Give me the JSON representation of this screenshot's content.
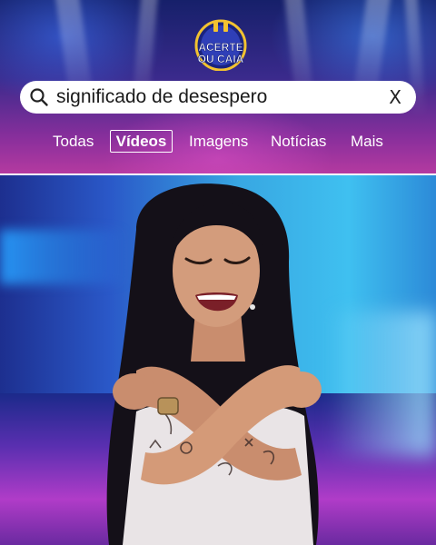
{
  "banner": {
    "logo_text_line1": "ACERTE",
    "logo_text_line2": "OU CAIA"
  },
  "search": {
    "query": "significado de desespero",
    "clear_label": "X"
  },
  "tabs": [
    {
      "label": "Todas",
      "selected": false
    },
    {
      "label": "Vídeos",
      "selected": true
    },
    {
      "label": "Imagens",
      "selected": false
    },
    {
      "label": "Notícias",
      "selected": false
    },
    {
      "label": "Mais",
      "selected": false
    }
  ],
  "icons": {
    "search": "search-icon",
    "clear": "close-icon"
  },
  "colors": {
    "search_bg": "#ffffff",
    "tab_text": "#ffffff",
    "banner_top": "#16206a",
    "banner_bottom": "#b43aa0"
  }
}
